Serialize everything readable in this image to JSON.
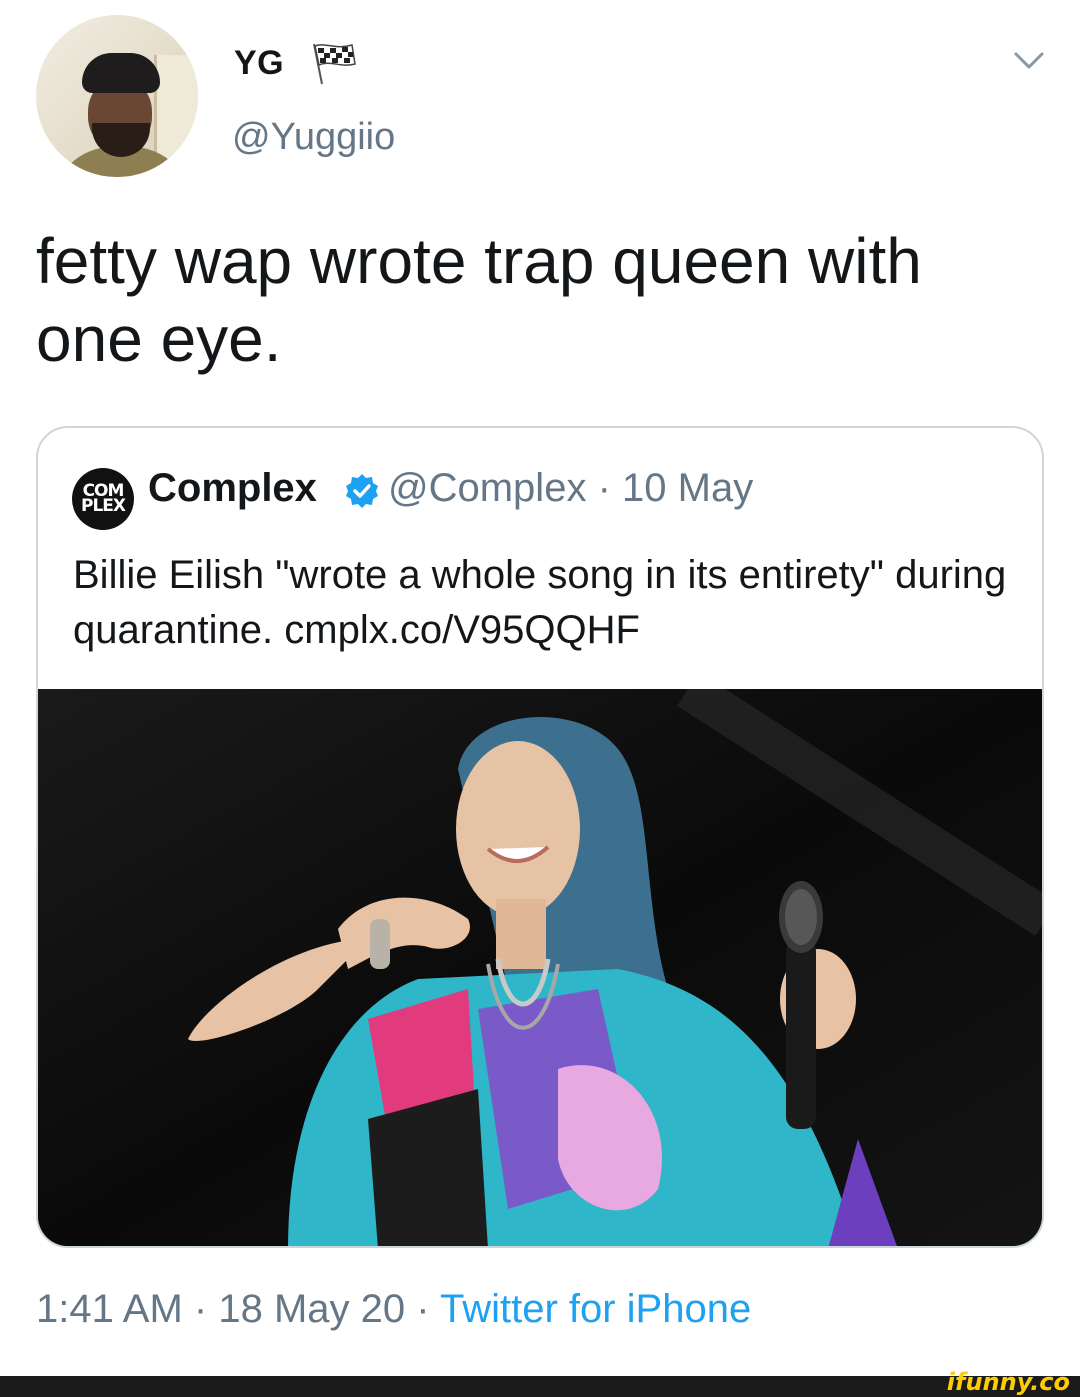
{
  "tweet": {
    "author": {
      "display_name": "YG",
      "handle": "@Yuggiio",
      "avatar_icon": "avatar-photo",
      "name_emoji": "chequered-flag-icon"
    },
    "menu_icon": "chevron-down-icon",
    "text": "fetty wap wrote trap queen with one eye.",
    "timestamp": "1:41 AM",
    "separator": "·",
    "date": "18 May 20",
    "source": "Twitter for iPhone"
  },
  "quoted_tweet": {
    "avatar_text_top": "COM",
    "avatar_text_bottom": "PLEX",
    "display_name": "Complex",
    "verified": true,
    "handle": "@Complex",
    "date": "10 May",
    "text": "Billie Eilish \"wrote a whole song in its entirety\" during quarantine. cmplx.co/V95QQHF",
    "image_icon": "photo-performer-with-microphone"
  },
  "watermark": "ifunny.co",
  "colors": {
    "text": "#14171a",
    "secondary": "#657786",
    "link": "#1da1f2",
    "border": "#ccd6dd",
    "watermark": "#ffcc00"
  }
}
